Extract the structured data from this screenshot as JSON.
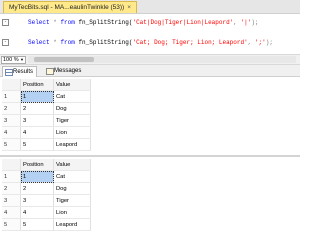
{
  "window": {
    "tab_title": "MyTecBits.sql - MA...eaulinTwinkle (53))",
    "close_glyph": "×"
  },
  "editor": {
    "collapse_glyph": "-",
    "line1": {
      "kw": "Select",
      "star": "*",
      "from": "from",
      "fn": "fn_SplitString(",
      "arg": "'Cat|Dog|Tiger|Lion|Leapord'",
      "comma": ",",
      "delim": "'|'",
      "end": ");"
    },
    "line2": {
      "kw": "Select",
      "star": "*",
      "from": "from",
      "fn": "fn_SplitString(",
      "arg": "'Cat; Dog; Tiger; Lion; Leapord'",
      "comma": ",",
      "delim": "';'",
      "end": ");"
    }
  },
  "zoom": {
    "value": "100 %"
  },
  "result_tabs": {
    "results": "Results",
    "messages": "Messages"
  },
  "grid1": {
    "columns": [
      "Position",
      "Value"
    ],
    "rows": [
      {
        "rn": "1",
        "pos": "1",
        "val": "Cat"
      },
      {
        "rn": "2",
        "pos": "2",
        "val": "Dog"
      },
      {
        "rn": "3",
        "pos": "3",
        "val": "Tiger"
      },
      {
        "rn": "4",
        "pos": "4",
        "val": "Lion"
      },
      {
        "rn": "5",
        "pos": "5",
        "val": "Leapord"
      }
    ]
  },
  "grid2": {
    "columns": [
      "Position",
      "Value"
    ],
    "rows": [
      {
        "rn": "1",
        "pos": "1",
        "val": "Cat"
      },
      {
        "rn": "2",
        "pos": "2",
        "val": "Dog"
      },
      {
        "rn": "3",
        "pos": "3",
        "val": "Tiger"
      },
      {
        "rn": "4",
        "pos": "4",
        "val": "Lion"
      },
      {
        "rn": "5",
        "pos": "5",
        "val": "Leapord"
      }
    ]
  }
}
